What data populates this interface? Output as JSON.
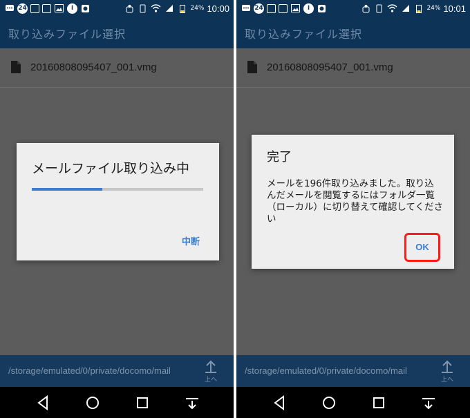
{
  "left": {
    "status_bar": {
      "badge": "24",
      "battery": "24%",
      "time": "10:00"
    },
    "app_bar": {
      "title": "取り込みファイル選択"
    },
    "file_list": [
      {
        "name": "20160808095407_001.vmg"
      }
    ],
    "dialog": {
      "title": "メールファイル取り込み中",
      "progress": 0.41,
      "button_label": "中断"
    },
    "path_bar": {
      "path": "/storage/emulated/0/private/docomo/mail",
      "up_label": "上へ"
    }
  },
  "right": {
    "status_bar": {
      "badge": "24",
      "battery": "24%",
      "time": "10:01"
    },
    "app_bar": {
      "title": "取り込みファイル選択"
    },
    "file_list": [
      {
        "name": "20160808095407_001.vmg"
      }
    ],
    "dialog": {
      "title": "完了",
      "message": "メールを196件取り込みました。取り込んだメールを閲覧するにはフォルダ一覧（ローカル）に切り替えて確認してください",
      "button_label": "OK",
      "highlight_color": "#ff1a1a"
    },
    "path_bar": {
      "path": "/storage/emulated/0/private/docomo/mail",
      "up_label": "上へ"
    }
  },
  "theme": {
    "app_bar_color": "#0d3357",
    "accent_color": "#3b7dd0",
    "scrim_color": "#5c5c5c",
    "dialog_color": "#eeeeee"
  },
  "nav_icons": [
    "back-icon",
    "home-icon",
    "recents-icon",
    "menu-icon"
  ]
}
